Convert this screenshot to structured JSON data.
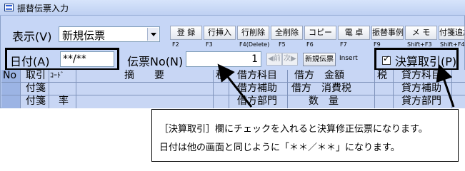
{
  "window": {
    "title": "振替伝票入力"
  },
  "display": {
    "label": "表示(V)",
    "selected": "新規伝票"
  },
  "toolbar": [
    {
      "label": "登 録",
      "key": "F2"
    },
    {
      "label": "行挿入",
      "key": "F3"
    },
    {
      "label": "行削除",
      "key": "F4(Delete)"
    },
    {
      "label": "全削除",
      "key": "F5"
    },
    {
      "label": "コピー",
      "key": "F6"
    },
    {
      "label": "電 卓",
      "key": "F7"
    },
    {
      "label": "振替事例",
      "key": "F9"
    },
    {
      "label": "メ モ",
      "key": "Shift+F3"
    },
    {
      "label": "付箋追加",
      "key": "Shift+F4"
    }
  ],
  "date": {
    "label": "日付(A)",
    "value": "**/**"
  },
  "voucher_no": {
    "label": "伝票No(N)",
    "value": "1"
  },
  "nav": {
    "prev": "◀前",
    "next": "次▶"
  },
  "new_voucher": {
    "label": "新規伝票",
    "hint": "Insert"
  },
  "settlement": {
    "label": "決算取引(P)",
    "checked": true,
    "mark": "✓"
  },
  "grid": {
    "no": "No",
    "row1": [
      "取引",
      "ｺｰﾄﾞ",
      "摘　　要",
      "税",
      "借方科目",
      "借方　金額",
      "税",
      "貸方科目"
    ],
    "row2": [
      "付箋",
      "借方補助",
      "借方　消費税",
      "貸方補助"
    ],
    "row3": [
      "付箋",
      "率",
      "借方部門",
      "数　量",
      "貸方部門"
    ]
  },
  "callout": {
    "line1": "［決算取引］欄にチェックを入れると決算修正伝票になります。",
    "line2": "日付は他の画面と同じように「＊＊／＊＊」になります。"
  }
}
